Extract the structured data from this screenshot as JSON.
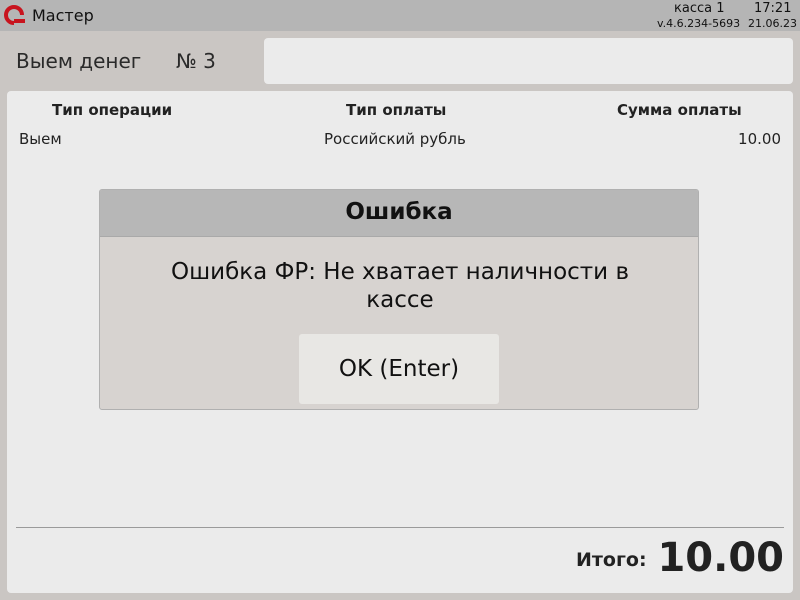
{
  "app": {
    "title": "Мастер",
    "logo_icon": "app-logo-icon",
    "logo_color": "#c8141e"
  },
  "status": {
    "register": "касса 1",
    "time": "17:21",
    "version": "v.4.6.234-5693",
    "date": "21.06.23"
  },
  "document": {
    "title": "Выем денег",
    "number": "№ 3"
  },
  "table": {
    "headers": {
      "operation_type": "Тип операции",
      "payment_type": "Тип оплаты",
      "amount": "Сумма оплаты"
    },
    "rows": [
      {
        "operation_type": "Выем",
        "payment_type": "Российский рубль",
        "amount": "10.00"
      }
    ]
  },
  "total": {
    "label": "Итого:",
    "value": "10.00"
  },
  "dialog": {
    "title": "Ошибка",
    "message": "Ошибка ФР: Не хватает наличности в кассе",
    "ok_label": "OK (Enter)"
  }
}
